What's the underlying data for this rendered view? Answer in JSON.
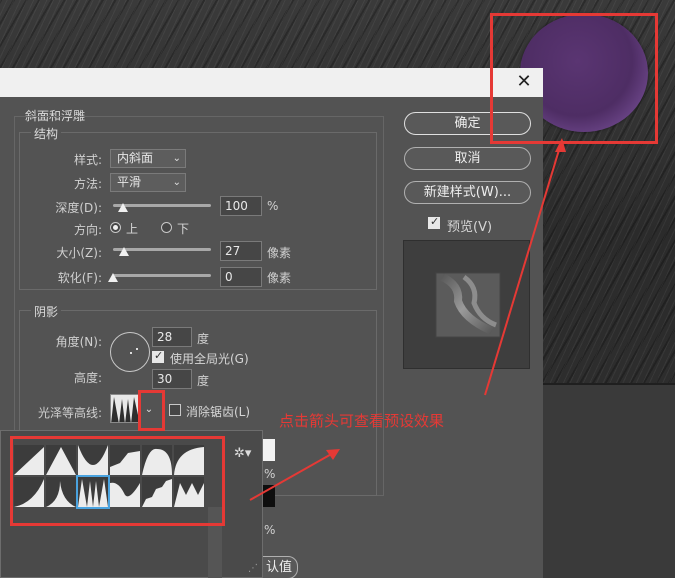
{
  "dialog": {
    "close_symbol": "✕",
    "section_bevel_emboss": "斜面和浮雕",
    "structure": {
      "title": "结构",
      "style_label": "样式:",
      "style_value": "内斜面",
      "method_label": "方法:",
      "method_value": "平滑",
      "depth_label": "深度(D):",
      "depth_value": "100",
      "depth_unit": "%",
      "depth_fraction": 0.1,
      "direction_label": "方向:",
      "direction_up": "上",
      "direction_down": "下",
      "size_label": "大小(Z):",
      "size_value": "27",
      "size_unit": "像素",
      "size_fraction": 0.11,
      "soften_label": "软化(F):",
      "soften_value": "0",
      "soften_unit": "像素",
      "soften_fraction": 0.0
    },
    "shading": {
      "title": "阴影",
      "angle_label": "角度(N):",
      "angle_value": "28",
      "angle_unit": "度",
      "global_light_label": "使用全局光(G)",
      "altitude_label": "高度:",
      "altitude_value": "30",
      "altitude_unit": "度",
      "gloss_contour_label": "光泽等高线:",
      "anti_alias_label": "消除锯齿(L)"
    },
    "partial_labels": {
      "pct1": "%",
      "pct2": "%",
      "default_value_fragment": "认值"
    },
    "buttons": {
      "ok": "确定",
      "cancel": "取消",
      "new_style": "新建样式(W)...",
      "preview": "预览(V)"
    }
  },
  "annotation": {
    "text": "点击箭头可查看预设效果",
    "color": "#e53935"
  },
  "colors": {
    "dialog_bg": "#535353",
    "sphere_purple": "#5a3572",
    "selection_blue": "#4aa3df"
  }
}
